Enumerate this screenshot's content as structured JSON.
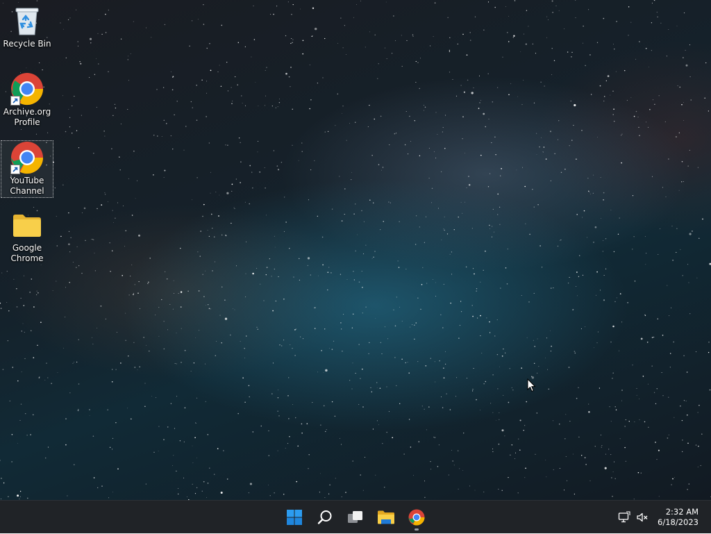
{
  "desktop": {
    "icons": [
      {
        "label": "Recycle Bin",
        "icon": "recycle-bin-icon",
        "shortcut": false,
        "selected": false
      },
      {
        "label": "Archive.org Profile",
        "icon": "chrome-icon",
        "shortcut": true,
        "selected": false
      },
      {
        "label": "YouTube Channel",
        "icon": "chrome-icon",
        "shortcut": true,
        "selected": true
      },
      {
        "label": "Google Chrome",
        "icon": "folder-icon",
        "shortcut": false,
        "selected": false
      }
    ]
  },
  "taskbar": {
    "pinned": [
      {
        "name": "start-button",
        "icon": "windows-logo-icon",
        "running": false
      },
      {
        "name": "search-button",
        "icon": "search-icon",
        "running": false
      },
      {
        "name": "task-view-button",
        "icon": "task-view-icon",
        "running": false
      },
      {
        "name": "file-explorer-button",
        "icon": "file-explorer-icon",
        "running": false
      },
      {
        "name": "chrome-taskbar-button",
        "icon": "chrome-icon",
        "running": true
      }
    ],
    "tray": {
      "network_icon": "network-icon",
      "volume_icon": "volume-muted-icon",
      "time": "2:32 AM",
      "date": "6/18/2023"
    }
  },
  "colors": {
    "taskbar_bg": "#202327",
    "accent_blue": "#0078d4",
    "chrome_red": "#db4437",
    "chrome_yellow": "#f4b400",
    "chrome_green": "#0f9d58",
    "chrome_blue": "#4285f4",
    "folder_yellow": "#f8cf4a"
  }
}
